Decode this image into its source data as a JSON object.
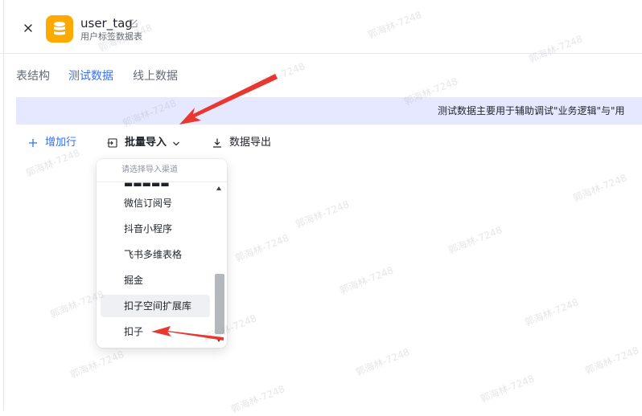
{
  "header": {
    "title": "user_tag",
    "subtitle": "用户标签数据表"
  },
  "tabs": [
    {
      "label": "表结构",
      "active": false
    },
    {
      "label": "测试数据",
      "active": true
    },
    {
      "label": "线上数据",
      "active": false
    }
  ],
  "notice": {
    "text": "测试数据主要用于辅助调试\"业务逻辑\"与\"用"
  },
  "toolbar": {
    "add_row_label": "增加行",
    "batch_import_label": "批量导入",
    "export_label": "数据导出"
  },
  "import_menu": {
    "header": "请选择导入渠道",
    "items": [
      {
        "label": "微信订阅号",
        "highlighted": false
      },
      {
        "label": "抖音小程序",
        "highlighted": false
      },
      {
        "label": "飞书多维表格",
        "highlighted": false
      },
      {
        "label": "掘金",
        "highlighted": false
      },
      {
        "label": "扣子空间扩展库",
        "highlighted": true
      },
      {
        "label": "扣子",
        "highlighted": false
      }
    ]
  },
  "watermark": {
    "text": "郭海林-7248"
  },
  "colors": {
    "accent": "#3370ff",
    "badge": "#ffaa00",
    "notice_bg": "#e6e8ff",
    "annotation": "#e8372f"
  },
  "icons": {
    "close": "close-icon",
    "database": "database-icon",
    "edit": "edit-icon",
    "add": "plus-icon",
    "import": "import-icon",
    "chevron": "chevron-down-icon",
    "export": "download-icon"
  }
}
